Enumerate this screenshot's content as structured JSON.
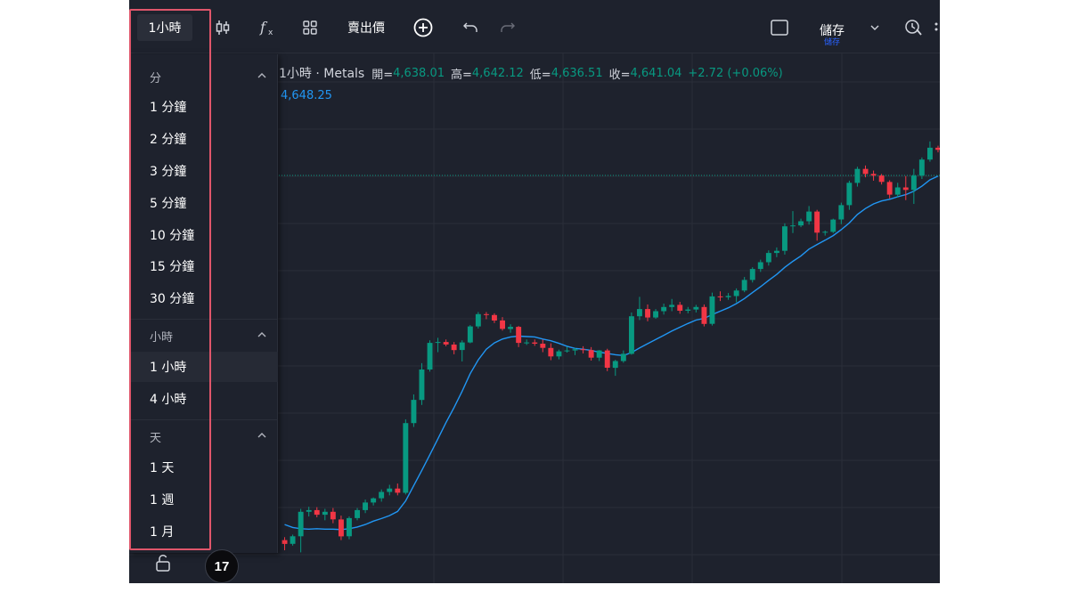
{
  "toolbar": {
    "timeframe": "1小時",
    "price_type": "賣出價",
    "save_main": "儲存",
    "save_sub": "儲存",
    "icons": [
      "candlestick-icon",
      "fx-indicators-icon",
      "layout-grid-icon",
      "plus-circle-icon",
      "undo-icon",
      "redo-icon",
      "square-icon",
      "chevron-down-icon",
      "alert-clock-icon"
    ]
  },
  "legend": {
    "symbol": "1小時 · Metals",
    "open_label": "開=",
    "open": "4,638.01",
    "high_label": "高=",
    "high": "4,642.12",
    "low_label": "低=",
    "low": "4,636.51",
    "close_label": "收=",
    "close": "4,641.04",
    "change": "+2.72 (+0.06%)",
    "ma_value": "4,648.25"
  },
  "menu": {
    "sections": [
      {
        "title": "分",
        "items": [
          "1 分鐘",
          "2 分鐘",
          "3 分鐘",
          "5 分鐘",
          "10 分鐘",
          "15 分鐘",
          "30 分鐘"
        ]
      },
      {
        "title": "小時",
        "items": [
          "1 小時",
          "4 小時"
        ]
      },
      {
        "title": "天",
        "items": [
          "1 天",
          "1 週",
          "1 月"
        ]
      }
    ],
    "active_item": "1 小時"
  },
  "logo": "17",
  "colors": {
    "up": "#089981",
    "down": "#f23645",
    "ma": "#2196f3",
    "background": "#1e222d",
    "highlight": "#e0566b"
  },
  "chart_data": {
    "type": "candlestick",
    "symbol": "Metals",
    "timeframe": "1小時",
    "ohlc": [
      [
        4548.2,
        4548.9,
        4545.8,
        4547.3
      ],
      [
        4547.3,
        4549.5,
        4546.9,
        4549.1
      ],
      [
        4549.1,
        4555.6,
        4545.3,
        4554.9
      ],
      [
        4554.9,
        4556.1,
        4553.8,
        4555.3
      ],
      [
        4555.3,
        4556.0,
        4553.6,
        4554.2
      ],
      [
        4554.2,
        4555.6,
        4552.9,
        4554.9
      ],
      [
        4554.9,
        4555.8,
        4552.2,
        4553.1
      ],
      [
        4553.1,
        4554.0,
        4548.2,
        4549.1
      ],
      [
        4549.1,
        4553.8,
        4548.4,
        4553.4
      ],
      [
        4553.4,
        4555.8,
        4552.9,
        4555.3
      ],
      [
        4555.3,
        4557.8,
        4554.6,
        4557.1
      ],
      [
        4557.1,
        4558.3,
        4556.4,
        4558.1
      ],
      [
        4558.1,
        4560.2,
        4557.3,
        4559.6
      ],
      [
        4559.6,
        4561.3,
        4558.8,
        4560.4
      ],
      [
        4560.4,
        4561.6,
        4558.8,
        4559.4
      ],
      [
        4559.4,
        4576.8,
        4559.0,
        4575.9
      ],
      [
        4575.9,
        4582.7,
        4575.0,
        4581.4
      ],
      [
        4581.4,
        4590.1,
        4580.2,
        4588.6
      ],
      [
        4588.6,
        4595.5,
        4588.1,
        4594.9
      ],
      [
        4594.9,
        4596.1,
        4592.7,
        4595.1
      ],
      [
        4595.1,
        4595.7,
        4594.1,
        4594.5
      ],
      [
        4594.5,
        4595.1,
        4592.2,
        4593.2
      ],
      [
        4593.2,
        4595.5,
        4590.5,
        4595.0
      ],
      [
        4595.0,
        4599.1,
        4594.8,
        4598.8
      ],
      [
        4598.8,
        4602.2,
        4598.3,
        4601.7
      ],
      [
        4601.7,
        4602.2,
        4600.5,
        4601.5
      ],
      [
        4601.5,
        4601.9,
        4599.6,
        4600.2
      ],
      [
        4600.2,
        4601.0,
        4597.8,
        4598.2
      ],
      [
        4598.2,
        4599.3,
        4597.3,
        4598.7
      ],
      [
        4598.7,
        4598.9,
        4593.9,
        4594.9
      ],
      [
        4594.9,
        4595.7,
        4594.4,
        4595.0
      ],
      [
        4595.0,
        4595.7,
        4594.2,
        4594.7
      ],
      [
        4594.7,
        4595.7,
        4592.7,
        4593.7
      ],
      [
        4593.7,
        4594.8,
        4590.8,
        4591.7
      ],
      [
        4591.7,
        4593.3,
        4591.0,
        4592.9
      ],
      [
        4592.9,
        4594.0,
        4592.6,
        4593.1
      ],
      [
        4593.1,
        4593.7,
        4592.0,
        4593.4
      ],
      [
        4593.4,
        4594.1,
        4592.4,
        4593.2
      ],
      [
        4593.2,
        4593.9,
        4590.7,
        4591.4
      ],
      [
        4591.4,
        4593.2,
        4590.6,
        4593.1
      ],
      [
        4593.1,
        4593.5,
        4588.2,
        4589.0
      ],
      [
        4589.0,
        4590.9,
        4587.1,
        4590.6
      ],
      [
        4590.6,
        4593.1,
        4590.2,
        4592.3
      ],
      [
        4592.3,
        4602.1,
        4592.1,
        4601.2
      ],
      [
        4601.2,
        4605.8,
        4600.3,
        4602.9
      ],
      [
        4602.9,
        4604.0,
        4600.0,
        4600.9
      ],
      [
        4600.9,
        4602.9,
        4600.6,
        4602.4
      ],
      [
        4602.4,
        4604.2,
        4601.6,
        4603.4
      ],
      [
        4603.4,
        4605.3,
        4602.4,
        4603.9
      ],
      [
        4603.9,
        4604.6,
        4601.8,
        4602.5
      ],
      [
        4602.5,
        4603.4,
        4601.9,
        4602.8
      ],
      [
        4602.8,
        4603.9,
        4602.1,
        4603.4
      ],
      [
        4603.4,
        4604.0,
        4598.8,
        4599.4
      ],
      [
        4599.4,
        4606.8,
        4599.0,
        4605.9
      ],
      [
        4605.9,
        4607.1,
        4604.8,
        4605.7
      ],
      [
        4605.7,
        4606.7,
        4605.1,
        4606.0
      ],
      [
        4606.0,
        4607.8,
        4604.5,
        4607.3
      ],
      [
        4607.3,
        4610.5,
        4606.9,
        4609.8
      ],
      [
        4609.8,
        4612.8,
        4609.2,
        4612.4
      ],
      [
        4612.4,
        4614.6,
        4611.7,
        4614.0
      ],
      [
        4614.0,
        4616.8,
        4613.2,
        4616.2
      ],
      [
        4616.2,
        4617.5,
        4615.2,
        4616.7
      ],
      [
        4616.7,
        4623.2,
        4615.8,
        4622.5
      ],
      [
        4622.5,
        4626.1,
        4620.9,
        4622.7
      ],
      [
        4622.7,
        4624.3,
        4622.3,
        4623.7
      ],
      [
        4623.7,
        4627.3,
        4622.9,
        4626.0
      ],
      [
        4626.0,
        4626.4,
        4619.1,
        4621.0
      ],
      [
        4621.0,
        4621.5,
        4620.3,
        4621.2
      ],
      [
        4621.2,
        4624.3,
        4620.9,
        4624.1
      ],
      [
        4624.1,
        4628.1,
        4623.0,
        4627.5
      ],
      [
        4627.5,
        4633.3,
        4626.4,
        4632.8
      ],
      [
        4632.8,
        4636.6,
        4631.9,
        4636.1
      ],
      [
        4636.1,
        4636.9,
        4634.1,
        4634.9
      ],
      [
        4634.9,
        4635.7,
        4633.3,
        4634.5
      ],
      [
        4634.5,
        4634.9,
        4632.4,
        4633.0
      ],
      [
        4633.0,
        4633.4,
        4629.1,
        4630.0
      ],
      [
        4630.0,
        4632.8,
        4629.3,
        4631.7
      ],
      [
        4631.7,
        4634.4,
        4628.7,
        4631.1
      ],
      [
        4631.1,
        4636.1,
        4627.8,
        4634.5
      ],
      [
        4634.5,
        4638.8,
        4633.7,
        4638.3
      ],
      [
        4638.3,
        4642.6,
        4637.8,
        4641.1
      ],
      [
        4641.1,
        4641.6,
        4640.0,
        4640.6
      ]
    ],
    "ma": [
      4551.9,
      4551.2,
      4550.9,
      4550.8,
      4550.9,
      4550.8,
      4550.8,
      4550.7,
      4550.9,
      4551.3,
      4551.9,
      4552.7,
      4553.3,
      4554.0,
      4555.0,
      4557.5,
      4561.1,
      4564.7,
      4568.4,
      4572.2,
      4576.0,
      4579.6,
      4583.4,
      4587.6,
      4590.9,
      4593.4,
      4594.9,
      4595.8,
      4596.3,
      4596.5,
      4596.4,
      4596.3,
      4595.8,
      4595.4,
      4594.8,
      4594.1,
      4593.6,
      4593.4,
      4593.1,
      4592.7,
      4592.4,
      4592.1,
      4591.9,
      4592.6,
      4593.7,
      4594.7,
      4595.7,
      4596.7,
      4597.7,
      4598.6,
      4599.5,
      4600.3,
      4600.7,
      4601.6,
      4602.4,
      4603.2,
      4604.2,
      4605.4,
      4606.8,
      4608.2,
      4609.7,
      4611.1,
      4612.8,
      4614.2,
      4615.5,
      4617.1,
      4618.2,
      4619.2,
      4620.3,
      4621.7,
      4623.3,
      4625.3,
      4626.7,
      4627.8,
      4628.5,
      4628.9,
      4629.5,
      4630.0,
      4630.8,
      4632.0,
      4633.5,
      4634.4
    ]
  }
}
